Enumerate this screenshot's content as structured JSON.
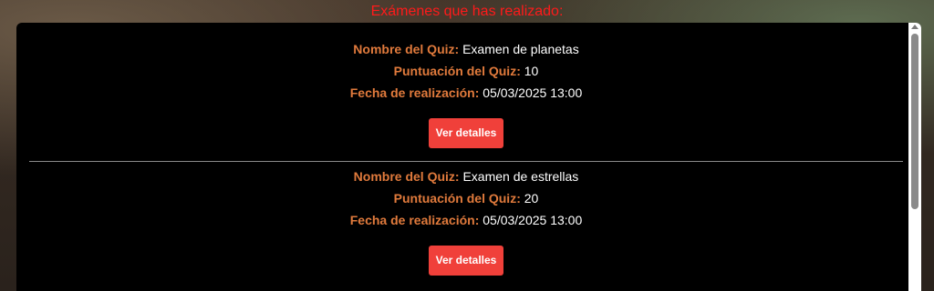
{
  "heading": "Exámenes que has realizado:",
  "labels": {
    "name": "Nombre del Quiz:",
    "score": "Puntuación del Quiz:",
    "date": "Fecha de realización:"
  },
  "quizzes": [
    {
      "name": "Examen de planetas",
      "score": "10",
      "date": "05/03/2025 13:00",
      "button": "Ver detalles"
    },
    {
      "name": "Examen de estrellas",
      "score": "20",
      "date": "05/03/2025 13:00",
      "button": "Ver detalles"
    }
  ],
  "colors": {
    "heading": "#ff1a1a",
    "label": "#e07a3c",
    "button": "#f0403a",
    "panel": "#000000"
  }
}
